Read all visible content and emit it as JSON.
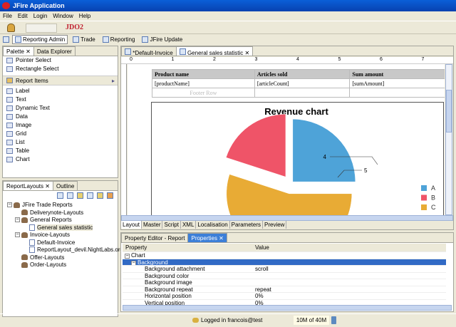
{
  "window": {
    "title": "JFire Application"
  },
  "menu": [
    "File",
    "Edit",
    "Login",
    "Window",
    "Help"
  ],
  "toolbar": {
    "org_label": "JDO2"
  },
  "perspectives": [
    {
      "label": "Reporting Admin",
      "active": true
    },
    {
      "label": "Trade"
    },
    {
      "label": "Reporting"
    },
    {
      "label": "JFire Update"
    }
  ],
  "palette": {
    "tabs": [
      "Palette",
      "Data Explorer"
    ],
    "tools": [
      "Pointer Select",
      "Rectangle Select"
    ],
    "drawer": "Report Items",
    "items": [
      "Label",
      "Text",
      "Dynamic Text",
      "Data",
      "Image",
      "Grid",
      "List",
      "Table",
      "Chart"
    ]
  },
  "layouts": {
    "tabs": [
      "ReportLayouts",
      "Outline"
    ],
    "tree": [
      {
        "label": "JFire Trade Reports",
        "level": 0,
        "type": "folder",
        "exp": "-"
      },
      {
        "label": "Deliverynote-Layouts",
        "level": 1,
        "type": "folder"
      },
      {
        "label": "General Reports",
        "level": 1,
        "type": "folder",
        "exp": "-"
      },
      {
        "label": "General sales statistic",
        "level": 2,
        "type": "doc",
        "selected": true
      },
      {
        "label": "Invoice-Layouts",
        "level": 1,
        "type": "folder",
        "exp": "-"
      },
      {
        "label": "Default-Invoice",
        "level": 2,
        "type": "doc"
      },
      {
        "label": "ReportLayout_devil.NightLabs.org_D",
        "level": 2,
        "type": "doc"
      },
      {
        "label": "Offer-Layouts",
        "level": 1,
        "type": "folder"
      },
      {
        "label": "Order-Layouts",
        "level": 1,
        "type": "folder"
      }
    ]
  },
  "editor": {
    "tabs": [
      "*Default-Invoice",
      "General sales statistic"
    ],
    "ruler": [
      "0",
      "1",
      "2",
      "3",
      "4",
      "5",
      "6",
      "7"
    ],
    "table": {
      "headers": [
        "Product name",
        "Articles sold",
        "Sum amount"
      ],
      "row": [
        "[productName]",
        "[articleCount]",
        "[sumAmount]"
      ],
      "footer": "Footer Row"
    },
    "bottom_tabs": [
      "Layout",
      "Master",
      "Script",
      "XML",
      "Localisation",
      "Parameters",
      "Preview"
    ]
  },
  "chart_data": {
    "type": "pie",
    "title": "Revenue chart",
    "categories": [
      "A",
      "B",
      "C"
    ],
    "values": [
      5,
      4,
      11
    ],
    "data_labels": [
      "5",
      "4"
    ],
    "colors": [
      "#4ea3d8",
      "#ef5468",
      "#e8ab35"
    ],
    "legend": "right"
  },
  "properties": {
    "tabs": [
      "Property Editor - Report",
      "Properties"
    ],
    "headers": [
      "Property",
      "Value"
    ],
    "rows": [
      {
        "p": "Chart",
        "v": "",
        "lvl": 0,
        "exp": "-"
      },
      {
        "p": "Background",
        "v": "",
        "lvl": 1,
        "exp": "-",
        "selected": true
      },
      {
        "p": "Background attachment",
        "v": "scroll",
        "lvl": 2
      },
      {
        "p": "Background color",
        "v": "",
        "lvl": 2
      },
      {
        "p": "Background image",
        "v": "",
        "lvl": 2
      },
      {
        "p": "Background repeat",
        "v": "repeat",
        "lvl": 2
      },
      {
        "p": "Horizontal position",
        "v": "0%",
        "lvl": 2
      },
      {
        "p": "Vertical position",
        "v": "0%",
        "lvl": 2
      }
    ]
  },
  "status": {
    "login": "Logged in francois@test",
    "memory": "10M of 40M"
  }
}
